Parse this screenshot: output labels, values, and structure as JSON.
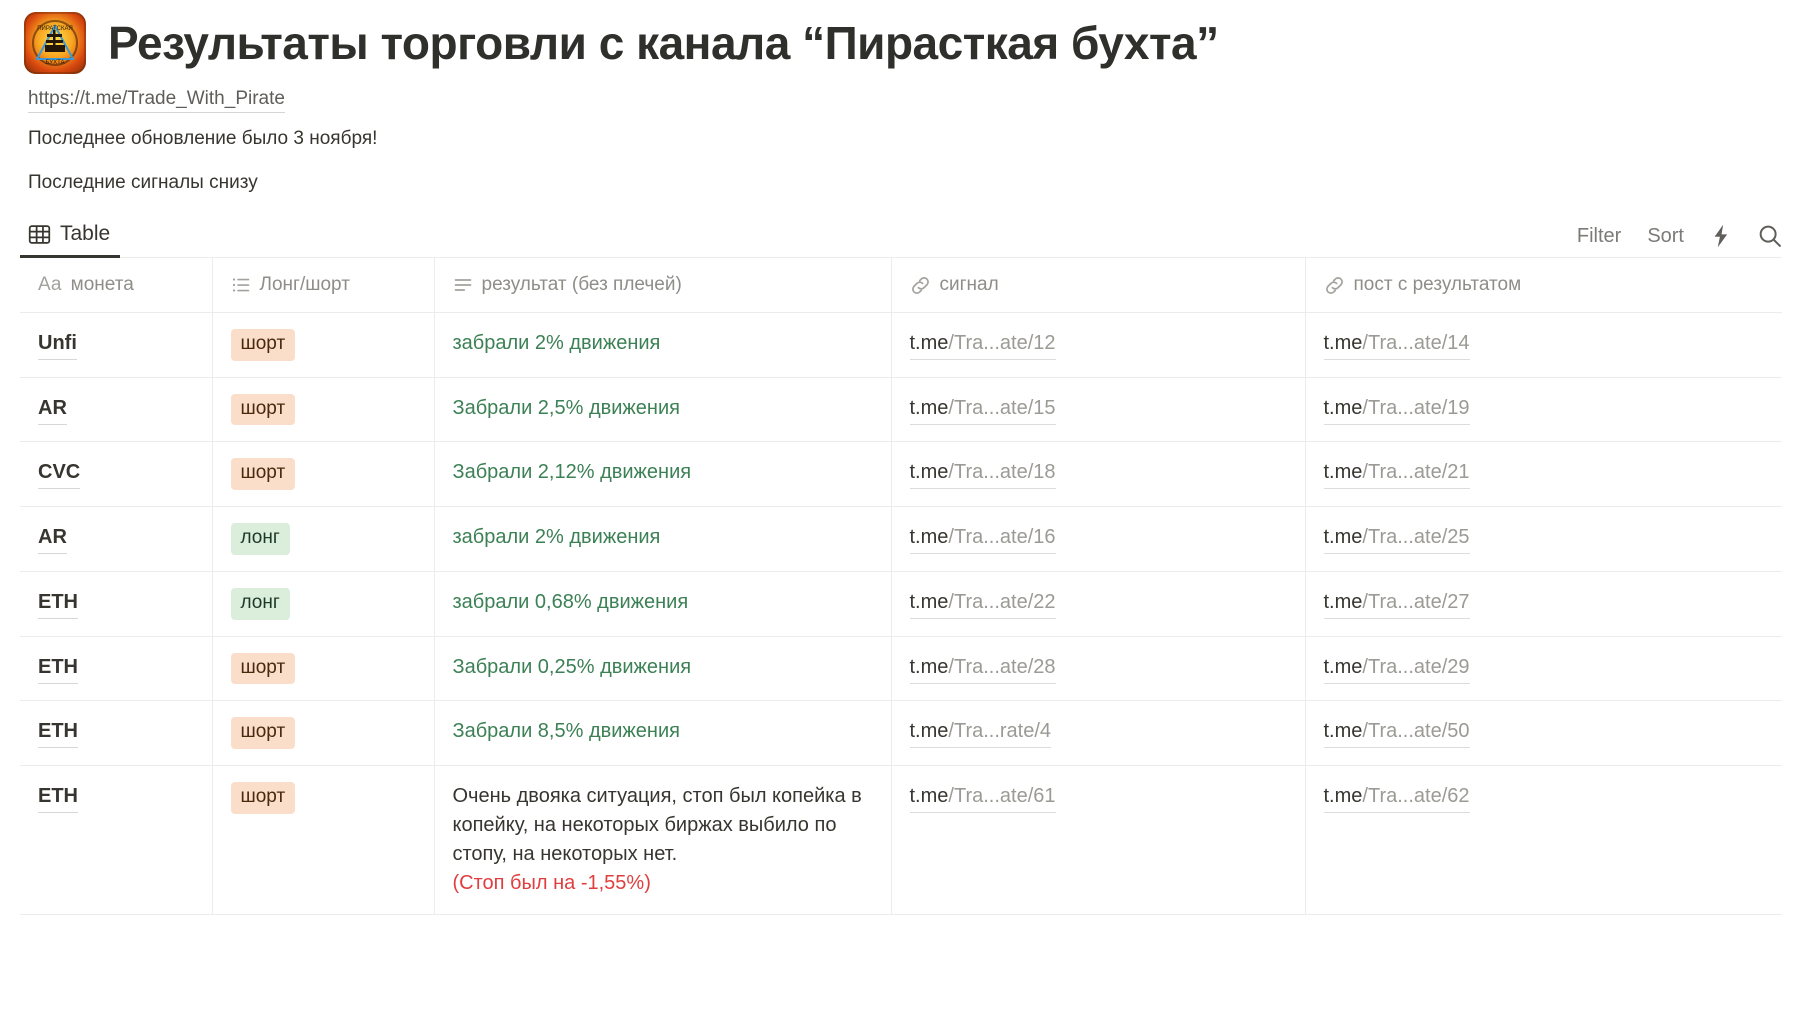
{
  "page": {
    "icon_name": "pirate-bay-channel-logo",
    "title": "Результаты торговли с канала “Пирасткая бухта”",
    "link_text": "https://t.me/Trade_With_Pirate",
    "line1": "Последнее обновление было 3 ноября!",
    "line2": "Последние сигналы снизу"
  },
  "toolbar": {
    "tab_label": "Table",
    "filter_label": "Filter",
    "sort_label": "Sort",
    "lightning_icon": "lightning-icon",
    "search_icon": "search-icon"
  },
  "table": {
    "columns": [
      {
        "label": "монета",
        "icon": "text-type-icon",
        "type_glyph": "Aa"
      },
      {
        "label": "Лонг/шорт",
        "icon": "select-list-icon"
      },
      {
        "label": "результат (без плечей)",
        "icon": "text-lines-icon"
      },
      {
        "label": "сигнал",
        "icon": "link-icon"
      },
      {
        "label": "пост с результатом",
        "icon": "link-icon"
      }
    ],
    "rows": [
      {
        "coin": "Unfi",
        "side": "шорт",
        "side_kind": "short",
        "result": "забрали 2% движения",
        "result_kind": "green",
        "signal_domain": "t.me",
        "signal_path": "/Tra...ate/12",
        "post_domain": "t.me",
        "post_path": "/Tra...ate/14"
      },
      {
        "coin": "AR",
        "side": "шорт",
        "side_kind": "short",
        "result": "Забрали 2,5% движения",
        "result_kind": "green",
        "signal_domain": "t.me",
        "signal_path": "/Tra...ate/15",
        "post_domain": "t.me",
        "post_path": "/Tra...ate/19"
      },
      {
        "coin": "CVC",
        "side": "шорт",
        "side_kind": "short",
        "result": "Забрали 2,12% движения",
        "result_kind": "green",
        "signal_domain": "t.me",
        "signal_path": "/Tra...ate/18",
        "post_domain": "t.me",
        "post_path": "/Tra...ate/21"
      },
      {
        "coin": "AR",
        "side": "лонг",
        "side_kind": "long",
        "result": "забрали 2% движения",
        "result_kind": "green",
        "signal_domain": "t.me",
        "signal_path": "/Tra...ate/16",
        "post_domain": "t.me",
        "post_path": "/Tra...ate/25"
      },
      {
        "coin": "ETH",
        "side": "лонг",
        "side_kind": "long",
        "result": "забрали 0,68% движения",
        "result_kind": "green",
        "signal_domain": "t.me",
        "signal_path": "/Tra...ate/22",
        "post_domain": "t.me",
        "post_path": "/Tra...ate/27"
      },
      {
        "coin": "ETH",
        "side": "шорт",
        "side_kind": "short",
        "result": "Забрали 0,25% движения",
        "result_kind": "green",
        "signal_domain": "t.me",
        "signal_path": "/Tra...ate/28",
        "post_domain": "t.me",
        "post_path": "/Tra...ate/29"
      },
      {
        "coin": "ETH",
        "side": "шорт",
        "side_kind": "short",
        "result": "Забрали 8,5% движения",
        "result_kind": "green",
        "signal_domain": "t.me",
        "signal_path": "/Tra...rate/4",
        "post_domain": "t.me",
        "post_path": "/Tra...ate/50"
      },
      {
        "coin": "ETH",
        "side": "шорт",
        "side_kind": "short",
        "result": "Очень двояка ситуация, стоп был копейка в копейку, на некоторых биржах выбило по стопу, на некоторых нет.",
        "result_kind": "plain",
        "result_note": "(Стоп был на -1,55%)",
        "signal_domain": "t.me",
        "signal_path": "/Tra...ate/61",
        "post_domain": "t.me",
        "post_path": "/Tra...ate/62"
      }
    ]
  },
  "colors": {
    "short_bg": "#fadec9",
    "long_bg": "#dbeddb",
    "green_text": "#3c8055",
    "red_text": "#e03e3e",
    "body_text": "#37352f",
    "muted_text": "#9b9a95"
  }
}
